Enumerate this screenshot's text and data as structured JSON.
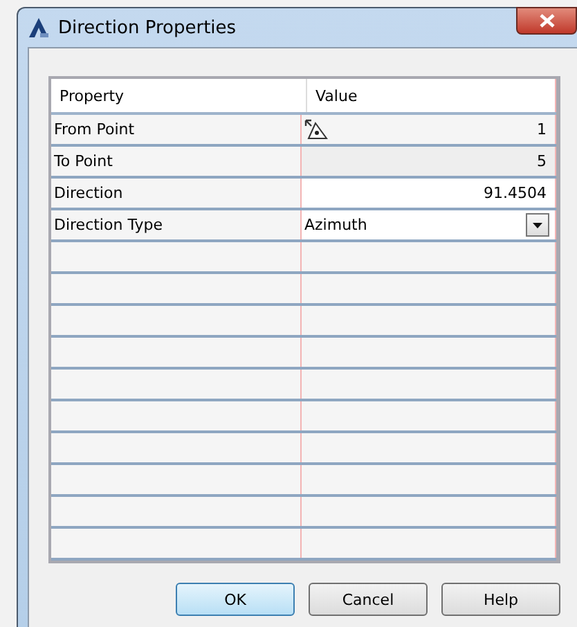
{
  "window": {
    "title": "Direction Properties"
  },
  "table": {
    "columns": [
      "Property",
      "Value"
    ],
    "rows": [
      {
        "property": "From Point",
        "value": "1",
        "kind": "picker"
      },
      {
        "property": "To Point",
        "value": "5",
        "kind": "readonly"
      },
      {
        "property": "Direction",
        "value": "91.4504",
        "kind": "number"
      },
      {
        "property": "Direction Type",
        "value": "Azimuth",
        "kind": "dropdown"
      }
    ]
  },
  "buttons": [
    {
      "label": "OK",
      "selected": true
    },
    {
      "label": "Cancel",
      "selected": false
    },
    {
      "label": "Help",
      "selected": false
    }
  ]
}
